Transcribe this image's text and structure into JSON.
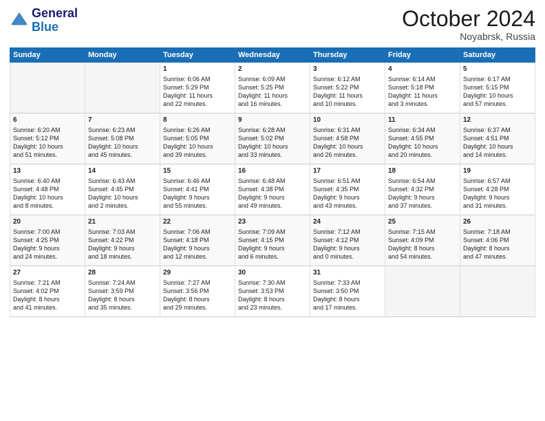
{
  "header": {
    "logo_general": "General",
    "logo_blue": "Blue",
    "month_title": "October 2024",
    "subtitle": "Noyabrsk, Russia"
  },
  "weekdays": [
    "Sunday",
    "Monday",
    "Tuesday",
    "Wednesday",
    "Thursday",
    "Friday",
    "Saturday"
  ],
  "weeks": [
    [
      {
        "day": "",
        "info": ""
      },
      {
        "day": "",
        "info": ""
      },
      {
        "day": "1",
        "info": "Sunrise: 6:06 AM\nSunset: 5:29 PM\nDaylight: 11 hours\nand 22 minutes."
      },
      {
        "day": "2",
        "info": "Sunrise: 6:09 AM\nSunset: 5:25 PM\nDaylight: 11 hours\nand 16 minutes."
      },
      {
        "day": "3",
        "info": "Sunrise: 6:12 AM\nSunset: 5:22 PM\nDaylight: 11 hours\nand 10 minutes."
      },
      {
        "day": "4",
        "info": "Sunrise: 6:14 AM\nSunset: 5:18 PM\nDaylight: 11 hours\nand 3 minutes."
      },
      {
        "day": "5",
        "info": "Sunrise: 6:17 AM\nSunset: 5:15 PM\nDaylight: 10 hours\nand 57 minutes."
      }
    ],
    [
      {
        "day": "6",
        "info": "Sunrise: 6:20 AM\nSunset: 5:12 PM\nDaylight: 10 hours\nand 51 minutes."
      },
      {
        "day": "7",
        "info": "Sunrise: 6:23 AM\nSunset: 5:08 PM\nDaylight: 10 hours\nand 45 minutes."
      },
      {
        "day": "8",
        "info": "Sunrise: 6:26 AM\nSunset: 5:05 PM\nDaylight: 10 hours\nand 39 minutes."
      },
      {
        "day": "9",
        "info": "Sunrise: 6:28 AM\nSunset: 5:02 PM\nDaylight: 10 hours\nand 33 minutes."
      },
      {
        "day": "10",
        "info": "Sunrise: 6:31 AM\nSunset: 4:58 PM\nDaylight: 10 hours\nand 26 minutes."
      },
      {
        "day": "11",
        "info": "Sunrise: 6:34 AM\nSunset: 4:55 PM\nDaylight: 10 hours\nand 20 minutes."
      },
      {
        "day": "12",
        "info": "Sunrise: 6:37 AM\nSunset: 4:51 PM\nDaylight: 10 hours\nand 14 minutes."
      }
    ],
    [
      {
        "day": "13",
        "info": "Sunrise: 6:40 AM\nSunset: 4:48 PM\nDaylight: 10 hours\nand 8 minutes."
      },
      {
        "day": "14",
        "info": "Sunrise: 6:43 AM\nSunset: 4:45 PM\nDaylight: 10 hours\nand 2 minutes."
      },
      {
        "day": "15",
        "info": "Sunrise: 6:46 AM\nSunset: 4:41 PM\nDaylight: 9 hours\nand 55 minutes."
      },
      {
        "day": "16",
        "info": "Sunrise: 6:48 AM\nSunset: 4:38 PM\nDaylight: 9 hours\nand 49 minutes."
      },
      {
        "day": "17",
        "info": "Sunrise: 6:51 AM\nSunset: 4:35 PM\nDaylight: 9 hours\nand 43 minutes."
      },
      {
        "day": "18",
        "info": "Sunrise: 6:54 AM\nSunset: 4:32 PM\nDaylight: 9 hours\nand 37 minutes."
      },
      {
        "day": "19",
        "info": "Sunrise: 6:57 AM\nSunset: 4:28 PM\nDaylight: 9 hours\nand 31 minutes."
      }
    ],
    [
      {
        "day": "20",
        "info": "Sunrise: 7:00 AM\nSunset: 4:25 PM\nDaylight: 9 hours\nand 24 minutes."
      },
      {
        "day": "21",
        "info": "Sunrise: 7:03 AM\nSunset: 4:22 PM\nDaylight: 9 hours\nand 18 minutes."
      },
      {
        "day": "22",
        "info": "Sunrise: 7:06 AM\nSunset: 4:18 PM\nDaylight: 9 hours\nand 12 minutes."
      },
      {
        "day": "23",
        "info": "Sunrise: 7:09 AM\nSunset: 4:15 PM\nDaylight: 9 hours\nand 6 minutes."
      },
      {
        "day": "24",
        "info": "Sunrise: 7:12 AM\nSunset: 4:12 PM\nDaylight: 9 hours\nand 0 minutes."
      },
      {
        "day": "25",
        "info": "Sunrise: 7:15 AM\nSunset: 4:09 PM\nDaylight: 8 hours\nand 54 minutes."
      },
      {
        "day": "26",
        "info": "Sunrise: 7:18 AM\nSunset: 4:06 PM\nDaylight: 8 hours\nand 47 minutes."
      }
    ],
    [
      {
        "day": "27",
        "info": "Sunrise: 7:21 AM\nSunset: 4:02 PM\nDaylight: 8 hours\nand 41 minutes."
      },
      {
        "day": "28",
        "info": "Sunrise: 7:24 AM\nSunset: 3:59 PM\nDaylight: 8 hours\nand 35 minutes."
      },
      {
        "day": "29",
        "info": "Sunrise: 7:27 AM\nSunset: 3:56 PM\nDaylight: 8 hours\nand 29 minutes."
      },
      {
        "day": "30",
        "info": "Sunrise: 7:30 AM\nSunset: 3:53 PM\nDaylight: 8 hours\nand 23 minutes."
      },
      {
        "day": "31",
        "info": "Sunrise: 7:33 AM\nSunset: 3:50 PM\nDaylight: 8 hours\nand 17 minutes."
      },
      {
        "day": "",
        "info": ""
      },
      {
        "day": "",
        "info": ""
      }
    ]
  ]
}
